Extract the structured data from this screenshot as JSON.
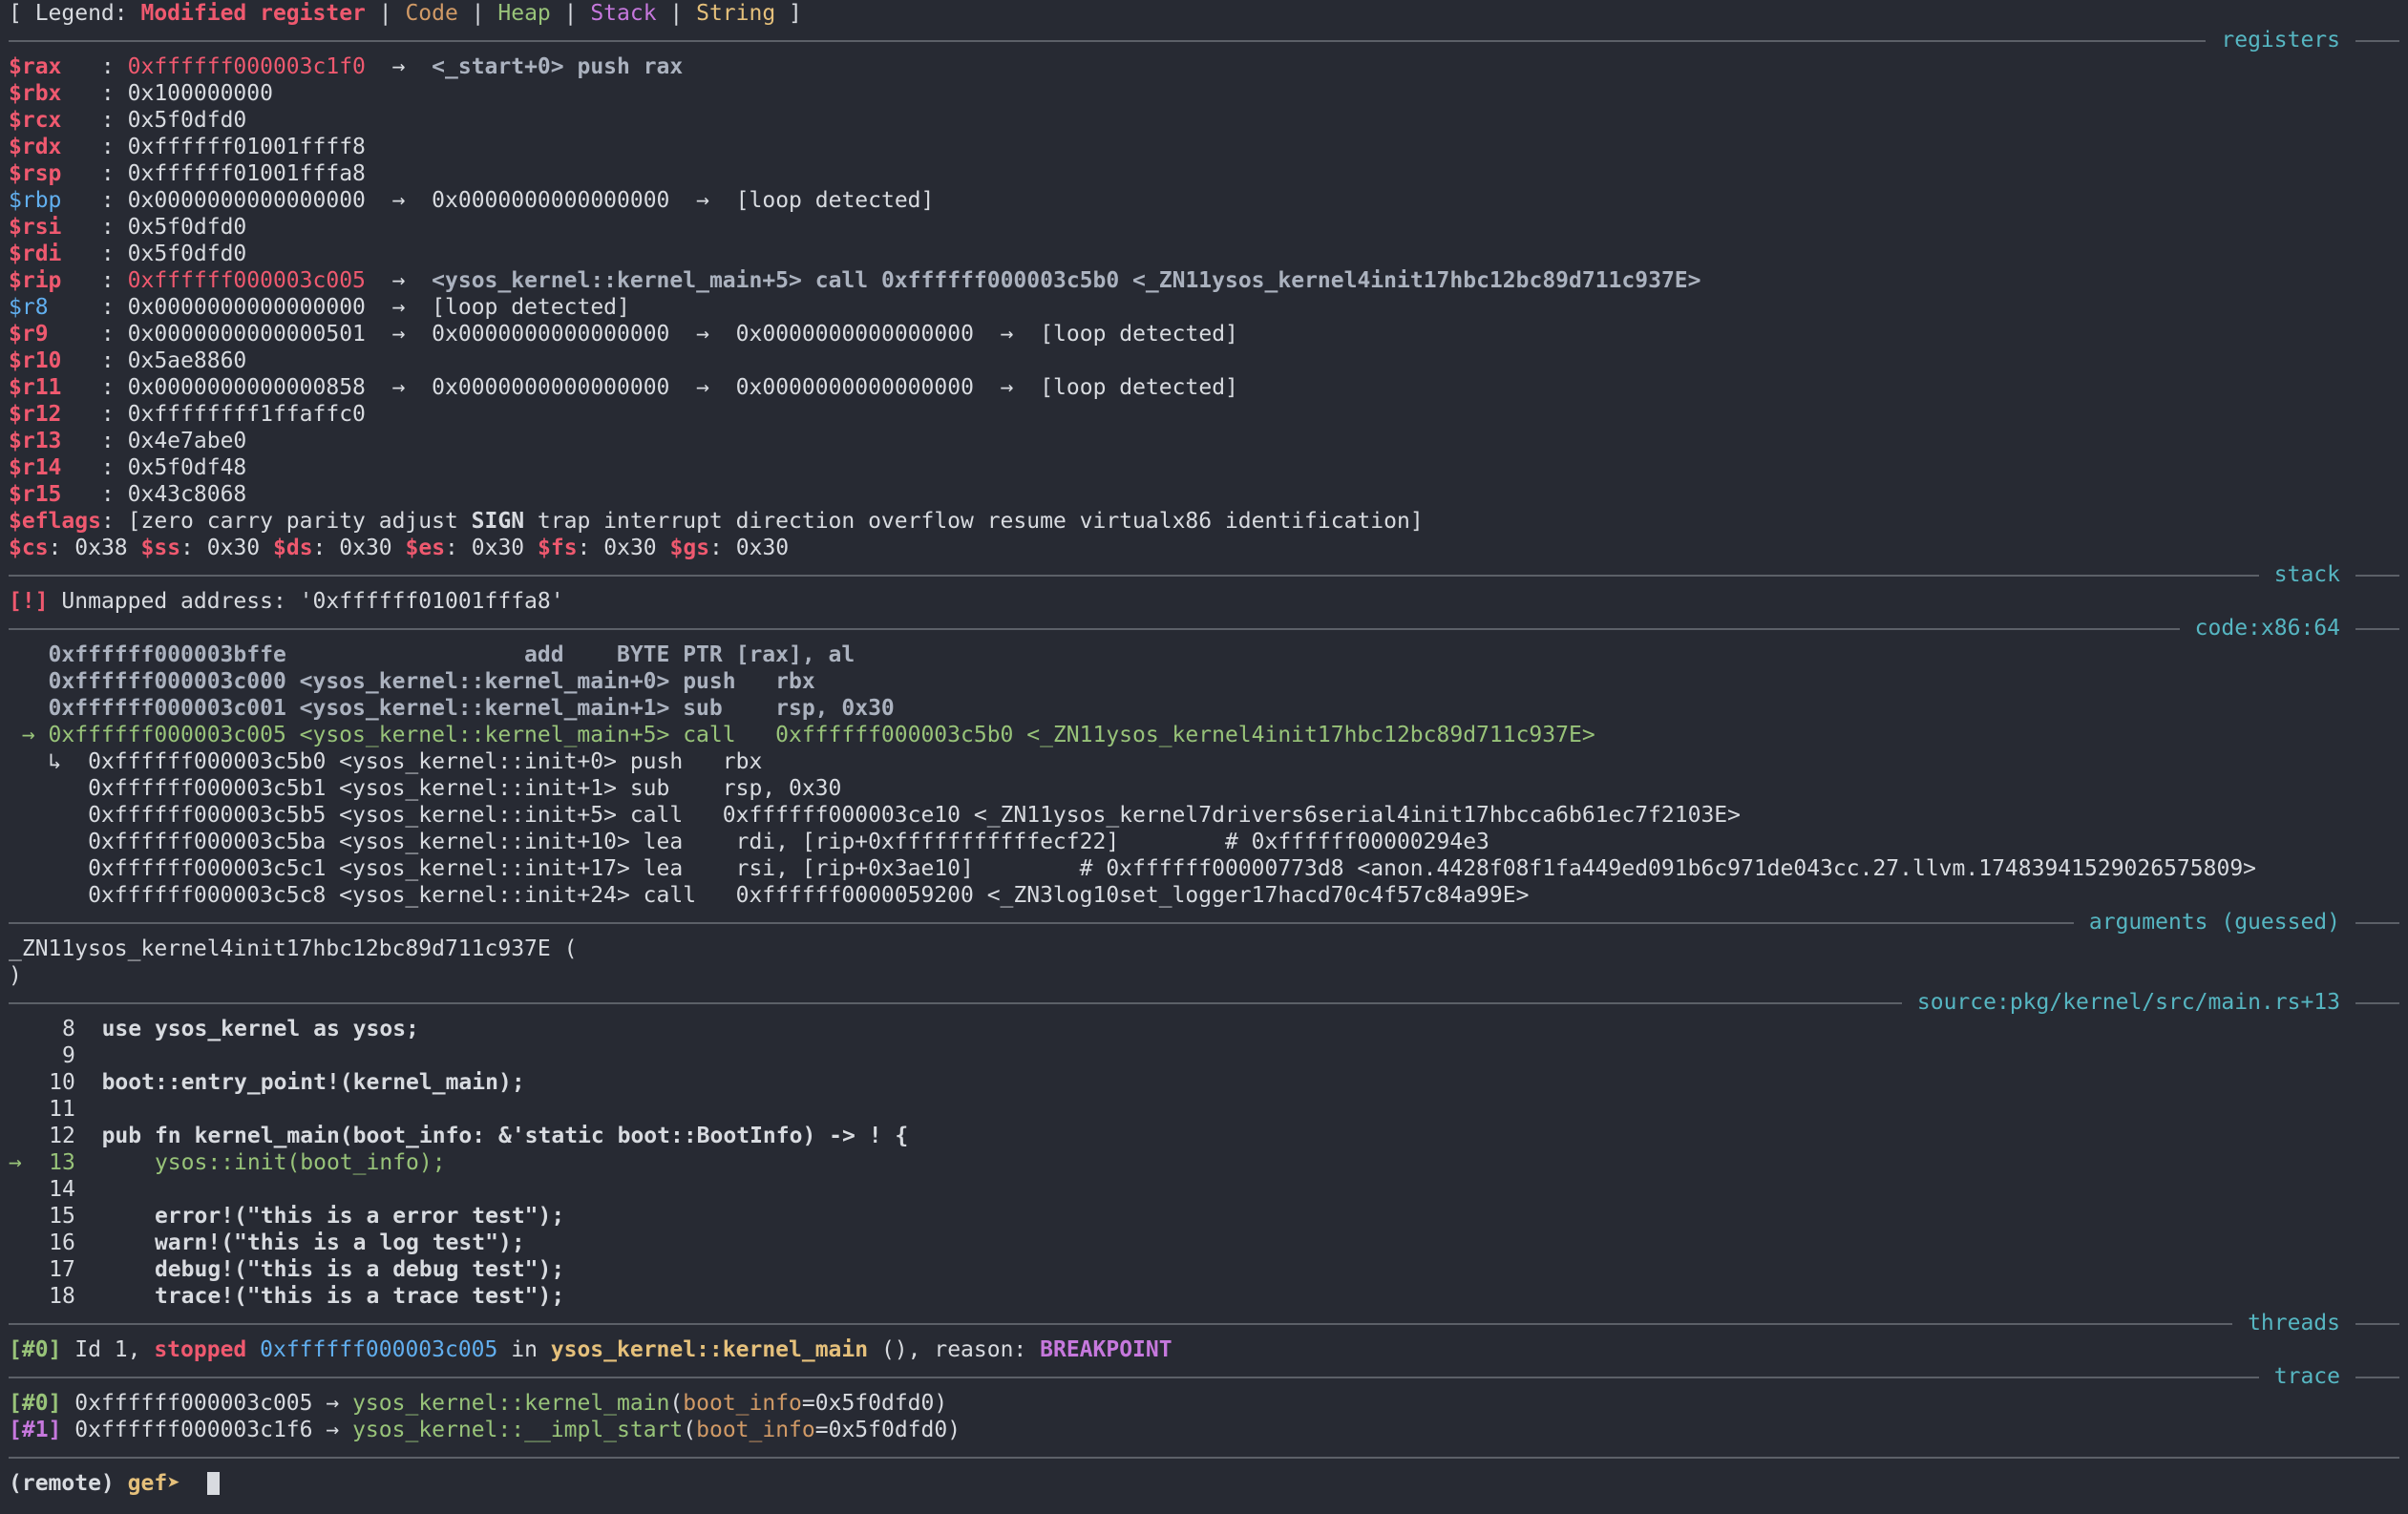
{
  "legend": {
    "open": "[ Legend: ",
    "modified": "Modified register",
    "sep": " | ",
    "code": "Code",
    "heap": "Heap",
    "stack": "Stack",
    "string": "String",
    "close": " ]"
  },
  "sections": {
    "registers": "registers",
    "stack": "stack",
    "code": "code:x86:64",
    "arguments": "arguments (guessed)",
    "source": "source:pkg/kernel/src/main.rs+13",
    "threads": "threads",
    "trace": "trace"
  },
  "arrow": "→",
  "registers": [
    {
      "name": "$rax",
      "value": "0xffffff000003c1f0",
      "chain": [],
      "tail": "<_start+0> push rax"
    },
    {
      "name": "$rbx",
      "value": "0x100000000",
      "chain": [],
      "tail": ""
    },
    {
      "name": "$rcx",
      "value": "0x5f0dfd0",
      "chain": [],
      "tail": ""
    },
    {
      "name": "$rdx",
      "value": "0xffffff01001ffff8",
      "chain": [],
      "tail": ""
    },
    {
      "name": "$rsp",
      "value": "0xffffff01001fffa8",
      "chain": [],
      "tail": ""
    },
    {
      "name": "$rbp",
      "value": "0x0000000000000000",
      "chain": [
        "0x0000000000000000"
      ],
      "tail": "[loop detected]"
    },
    {
      "name": "$rsi",
      "value": "0x5f0dfd0",
      "chain": [],
      "tail": ""
    },
    {
      "name": "$rdi",
      "value": "0x5f0dfd0",
      "chain": [],
      "tail": ""
    },
    {
      "name": "$rip",
      "value": "0xffffff000003c005",
      "chain": [],
      "tail": "<ysos_kernel::kernel_main+5> call 0xffffff000003c5b0 <_ZN11ysos_kernel4init17hbc12bc89d711c937E>"
    },
    {
      "name": "$r8",
      "value": "0x0000000000000000",
      "chain": [],
      "tail": "[loop detected]"
    },
    {
      "name": "$r9",
      "value": "0x0000000000000501",
      "chain": [
        "0x0000000000000000",
        "0x0000000000000000"
      ],
      "tail": "[loop detected]"
    },
    {
      "name": "$r10",
      "value": "0x5ae8860",
      "chain": [],
      "tail": ""
    },
    {
      "name": "$r11",
      "value": "0x0000000000000858",
      "chain": [
        "0x0000000000000000",
        "0x0000000000000000"
      ],
      "tail": "[loop detected]"
    },
    {
      "name": "$r12",
      "value": "0xffffffff1ffaffc0",
      "chain": [],
      "tail": ""
    },
    {
      "name": "$r13",
      "value": "0x4e7abe0",
      "chain": [],
      "tail": ""
    },
    {
      "name": "$r14",
      "value": "0x5f0df48",
      "chain": [],
      "tail": ""
    },
    {
      "name": "$r15",
      "value": "0x43c8068",
      "chain": [],
      "tail": ""
    }
  ],
  "eflags": {
    "label": "$eflags",
    "before": "[zero carry parity adjust ",
    "sign": "SIGN",
    "after": " trap interrupt direction overflow resume virtualx86 identification]"
  },
  "segments": [
    {
      "name": "$cs",
      "value": "0x38"
    },
    {
      "name": "$ss",
      "value": "0x30"
    },
    {
      "name": "$ds",
      "value": "0x30"
    },
    {
      "name": "$es",
      "value": "0x30"
    },
    {
      "name": "$fs",
      "value": "0x30"
    },
    {
      "name": "$gs",
      "value": "0x30"
    }
  ],
  "stack": {
    "tag": "[!]",
    "message": "Unmapped address: '0xffffff01001fffa8'"
  },
  "code": [
    {
      "text": "   0xffffff000003bffe                  add    BYTE PTR [rax], al",
      "style": "gryb"
    },
    {
      "text": "   0xffffff000003c000 <ysos_kernel::kernel_main+0> push   rbx",
      "style": "gryb"
    },
    {
      "text": "   0xffffff000003c001 <ysos_kernel::kernel_main+1> sub    rsp, 0x30",
      "style": "gryb"
    },
    {
      "text": " → 0xffffff000003c005 <ysos_kernel::kernel_main+5> call   0xffffff000003c5b0 <_ZN11ysos_kernel4init17hbc12bc89d711c937E>",
      "style": "grn"
    },
    {
      "text": "   ↳  0xffffff000003c5b0 <ysos_kernel::init+0> push   rbx",
      "style": "plain"
    },
    {
      "text": "      0xffffff000003c5b1 <ysos_kernel::init+1> sub    rsp, 0x30",
      "style": "plain"
    },
    {
      "text": "      0xffffff000003c5b5 <ysos_kernel::init+5> call   0xffffff000003ce10 <_ZN11ysos_kernel7drivers6serial4init17hbcca6b61ec7f2103E>",
      "style": "plain"
    },
    {
      "text": "      0xffffff000003c5ba <ysos_kernel::init+10> lea    rdi, [rip+0xfffffffffffecf22]        # 0xffffff00000294e3",
      "style": "plain"
    },
    {
      "text": "      0xffffff000003c5c1 <ysos_kernel::init+17> lea    rsi, [rip+0x3ae10]        # 0xffffff00000773d8 <anon.4428f08f1fa449ed091b6c971de043cc.27.llvm.17483941529026575809>",
      "style": "plain"
    },
    {
      "text": "      0xffffff000003c5c8 <ysos_kernel::init+24> call   0xffffff0000059200 <_ZN3log10set_logger17hacd70c4f57c84a99E>",
      "style": "plain"
    }
  ],
  "arguments": {
    "line1": "_ZN11ysos_kernel4init17hbc12bc89d711c937E (",
    "line2": ")"
  },
  "source": [
    {
      "num": "8",
      "code": "use ysos_kernel as ysos;",
      "current": false
    },
    {
      "num": "9",
      "code": "",
      "current": false
    },
    {
      "num": "10",
      "code": "boot::entry_point!(kernel_main);",
      "current": false
    },
    {
      "num": "11",
      "code": "",
      "current": false
    },
    {
      "num": "12",
      "code": "pub fn kernel_main(boot_info: &'static boot::BootInfo) -> ! {",
      "current": false
    },
    {
      "num": "13",
      "code": "    ysos::init(boot_info);",
      "current": true
    },
    {
      "num": "14",
      "code": "",
      "current": false
    },
    {
      "num": "15",
      "code": "    error!(\"this is a error test\");",
      "current": false
    },
    {
      "num": "16",
      "code": "    warn!(\"this is a log test\");",
      "current": false
    },
    {
      "num": "17",
      "code": "    debug!(\"this is a debug test\");",
      "current": false
    },
    {
      "num": "18",
      "code": "    trace!(\"this is a trace test\");",
      "current": false
    }
  ],
  "thread": {
    "tag": "[#0]",
    "pre": " Id 1, ",
    "stopped": "stopped",
    "addr": "0xffffff000003c005",
    "in": " in ",
    "func": "ysos_kernel::kernel_main",
    "mid": " (), reason: ",
    "reason": "BREAKPOINT"
  },
  "trace": [
    {
      "tag": "[#0]",
      "addr": "0xffffff000003c005",
      "func": "ysos_kernel::kernel_main",
      "arg": "boot_info",
      "val": "=0x5f0dfd0)"
    },
    {
      "tag": "[#1]",
      "addr": "0xffffff000003c1f6",
      "func": "ysos_kernel::__impl_start",
      "arg": "boot_info",
      "val": "=0x5f0dfd0)"
    }
  ],
  "prompt": {
    "remote": "(remote) ",
    "gef": "gef➤",
    "trail": "  "
  },
  "colors": {
    "modified": "#ef596f",
    "code": "#d19a66",
    "heap": "#98c379",
    "stack": "#c678dd",
    "string": "#e5c07b",
    "section_title": "#56b6c2",
    "background": "#272a33"
  }
}
